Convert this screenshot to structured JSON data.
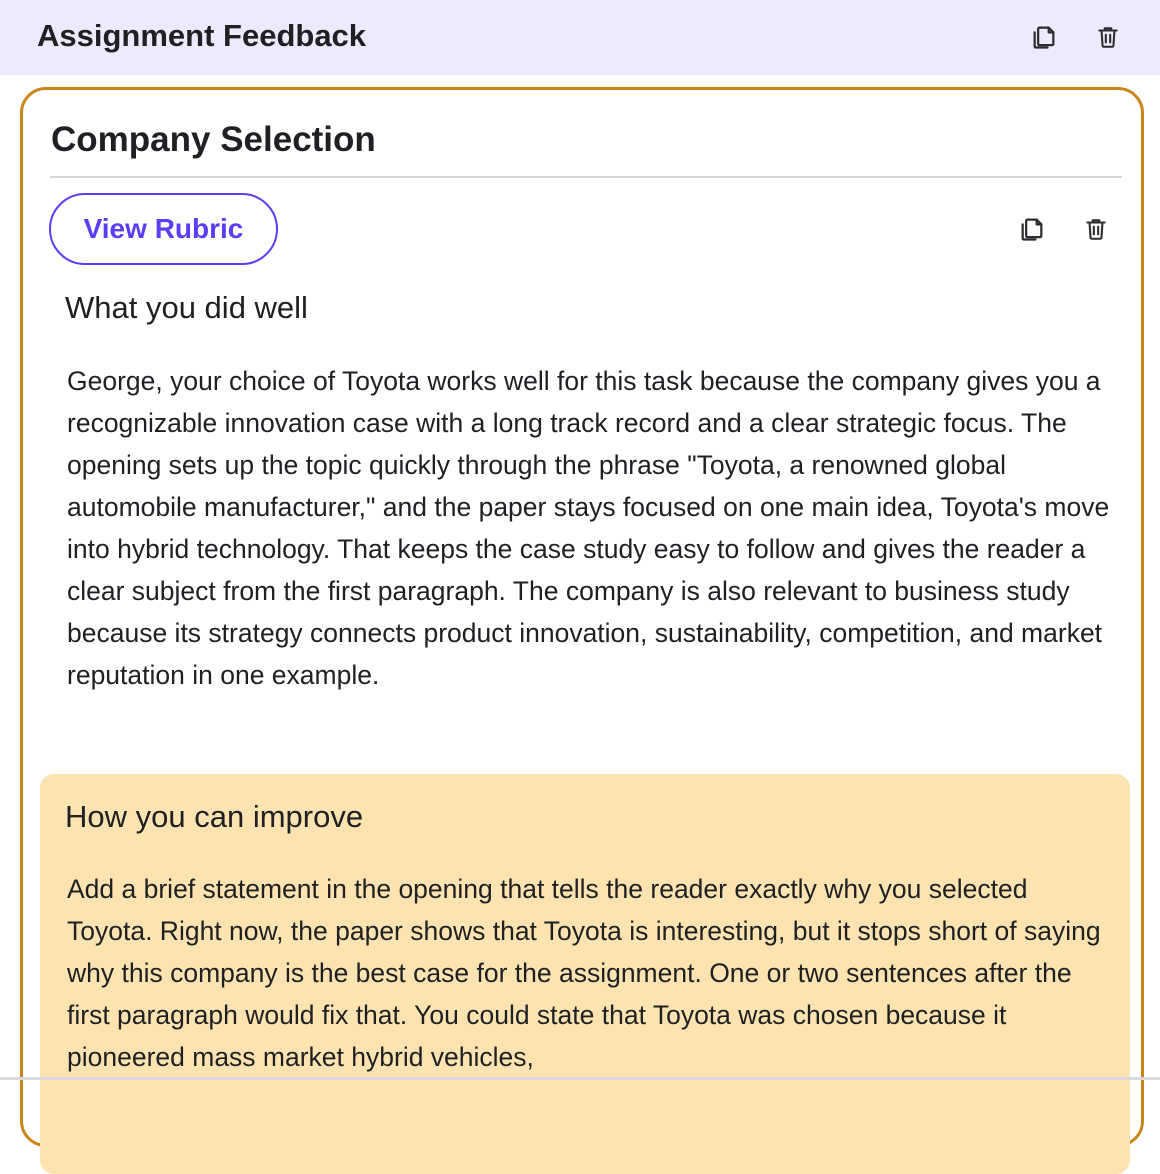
{
  "header": {
    "title": "Assignment Feedback",
    "icons": [
      "copy-icon",
      "trash-icon"
    ]
  },
  "card": {
    "title": "Company Selection",
    "rubric_button_label": "View Rubric",
    "icons": [
      "copy-icon",
      "trash-icon"
    ],
    "well": {
      "heading": "What you did well",
      "body": "George, your choice of Toyota works well for this task because the company gives you a recognizable innovation case with a long track record and a clear strategic focus. The opening sets up the topic quickly through the phrase \"Toyota, a renowned global automobile manufacturer,\" and the paper stays focused on one main idea, Toyota's move into hybrid technology. That keeps the case study easy to follow and gives the reader a clear subject from the first paragraph. The company is also relevant to business study because its strategy connects product innovation, sustainability, competition, and market reputation in one example."
    },
    "improve": {
      "heading": "How you can improve",
      "body": "Add a brief statement in the opening that tells the reader exactly why you selected Toyota. Right now, the paper shows that Toyota is interesting, but it stops short of saying why this company is the best case for the assignment. One or two sentences after the first paragraph would fix that. You could state that Toyota was chosen because it pioneered mass market hybrid vehicles,"
    }
  },
  "colors": {
    "header_bg": "#eceafd",
    "card_border": "#c8851a",
    "accent": "#5b3df5",
    "improve_bg": "#fde3b0"
  }
}
